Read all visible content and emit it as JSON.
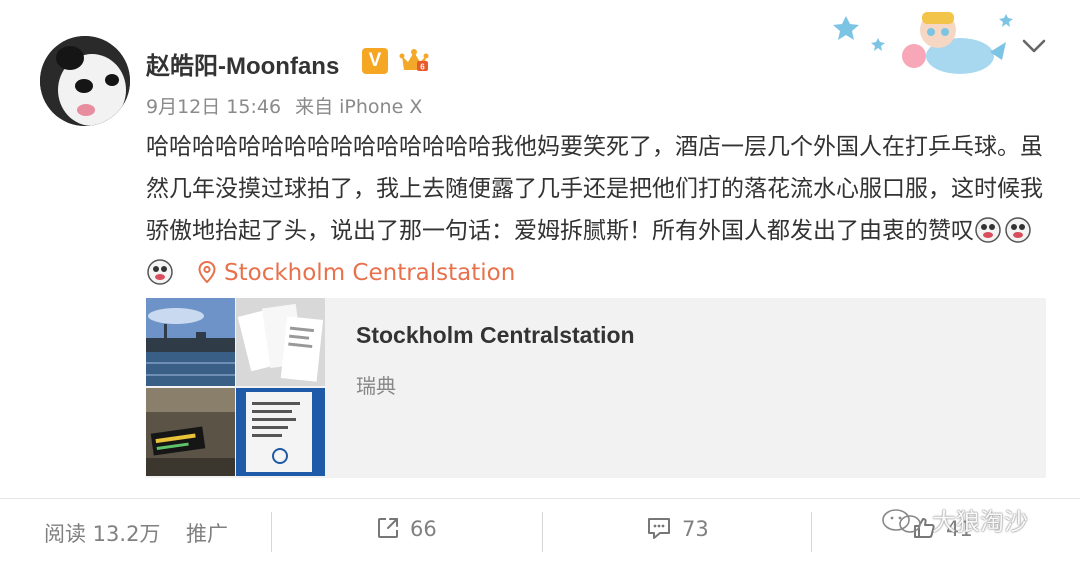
{
  "post": {
    "username": "赵皓阳-Moonfans",
    "verified_badge": "V",
    "date": "9月12日 15:46",
    "source": "来自 iPhone X",
    "text": "哈哈哈哈哈哈哈哈哈哈哈哈哈哈哈我他妈要笑死了，酒店一层几个外国人在打乒乓球。虽然几年没摸过球拍了，我上去随便露了几手还是把他们打的落花流水心服口服，这时候我骄傲地抬起了头，说出了那一句话：爱姆拆腻斯！所有外国人都发出了由衷的赞叹",
    "location_link": "Stockholm Centralstation",
    "icons": [
      "avatar-panda",
      "verified-v-badge",
      "crown-badge",
      "decoration-character",
      "chevron-down-icon",
      "laughing-emoji",
      "location-pin-icon"
    ]
  },
  "place": {
    "title": "Stockholm Centralstation",
    "subtitle": "瑞典",
    "thumbnails": [
      "harbor-photo",
      "tickets-photo",
      "station-board-photo",
      "sign-photo"
    ],
    "sign_text": "Kösystemet är för tillfället ur funktion. Gå till valfri kassa."
  },
  "footer": {
    "reads": "阅读 13.2万",
    "promote": "推广",
    "repost_count": "66",
    "comment_count": "73",
    "like_count": "41",
    "icons": [
      "repost-icon",
      "comment-icon",
      "like-icon"
    ]
  },
  "watermark": {
    "text": "大狼淘沙"
  },
  "colors": {
    "location": "#e8714c",
    "badge": "#f5a623",
    "muted": "#808080",
    "card_bg": "#f2f2f2"
  }
}
